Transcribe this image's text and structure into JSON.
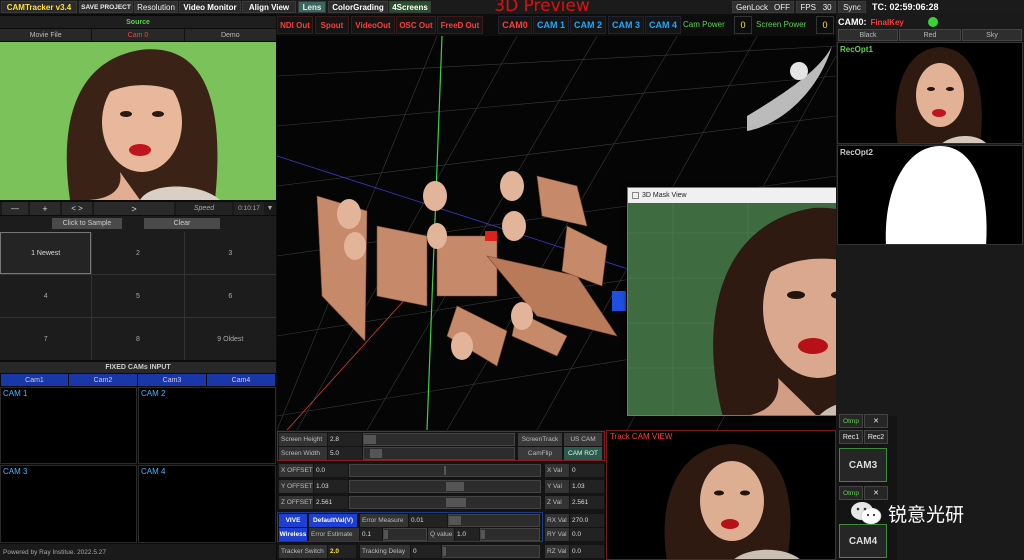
{
  "app": {
    "title": "CAMTracker v3.4",
    "footer": "Powered by Ray Institue. 2022.5.27",
    "watermark": "锐意光研"
  },
  "topbar": {
    "save_project": "SAVE PROJECT",
    "resolution": "Resolution",
    "video_monitor": "Video Monitor",
    "align_view": "Align View",
    "lens": "Lens",
    "color_grading": "ColorGrading",
    "four_screens": "4Screens",
    "genlock_label": "GenLock",
    "genlock_value": "OFF",
    "fps_label": "FPS",
    "fps_value": "30",
    "sync_label": "Sync",
    "timecode": "TC: 02:59:06:28"
  },
  "preview": {
    "title": "3D Preview"
  },
  "outputs": [
    "NDI Out",
    "Spout",
    "VideoOut",
    "OSC Out",
    "FreeD Out"
  ],
  "cams": [
    "CAM0",
    "CAM 1",
    "CAM 2",
    "CAM 3",
    "CAM 4"
  ],
  "cam_power_label": "Cam Power",
  "cam_power_value": "0",
  "screen_power_label": "Screen Power",
  "screen_power_value": "0",
  "source": {
    "header": "Source",
    "tabs": [
      "Movie File",
      "Cam 0",
      "Demo"
    ],
    "transport": {
      "minus": "—",
      "plus": "+",
      "swap": "< >",
      "next": ">",
      "speed_label": "Speed",
      "time": "0:10:17"
    },
    "click_to_sample": "Click to Sample",
    "clear": "Clear",
    "slots": [
      "1 Newest",
      "2",
      "3",
      "4",
      "5",
      "6",
      "7",
      "8",
      "9 Oldest"
    ]
  },
  "fixed_cams": {
    "header": "FIXED CAMs INPUT",
    "selectors": [
      "Cam1",
      "Cam2",
      "Cam3",
      "Cam4"
    ],
    "views": [
      "CAM 1",
      "CAM 2",
      "CAM 3",
      "CAM 4"
    ]
  },
  "controls": {
    "screen_height_label": "Screen Height",
    "screen_height_value": "2.8",
    "screen_width_label": "Screen Width",
    "screen_width_value": "5.0",
    "screen_track": "ScreenTrack",
    "us_cam": "US CAM",
    "cam_flip": "CamFlip",
    "cam_rot": "CAM ROT",
    "x_offset_label": "X OFFSET",
    "x_offset_value": "0.0",
    "y_offset_label": "Y OFFSET",
    "y_offset_value": "1.03",
    "z_offset_label": "Z OFFSET",
    "z_offset_value": "2.561",
    "x_val_label": "X Val",
    "x_val_value": "0",
    "y_val_label": "Y Val",
    "y_val_value": "1.03",
    "z_val_label": "Z Val",
    "z_val_value": "2.561",
    "vive": "VIVE",
    "default_val": "DefaultVal(V)",
    "error_measure_label": "Error Measure",
    "error_measure_value": "0.01",
    "wireless": "Wireless",
    "error_estimate_label": "Error Estimate",
    "error_estimate_value": "0.1",
    "q_value_label": "Q value",
    "q_value_value": "1.0",
    "tracker_switch_label": "Tracker Switch",
    "tracker_switch_value": "2.0",
    "tracking_delay_label": "Tracking Delay",
    "tracking_delay_value": "0",
    "rx_val_label": "RX Val",
    "rx_val_value": "270.0",
    "ry_val_label": "RY Val",
    "ry_val_value": "0.0",
    "rz_val_label": "RZ Val",
    "rz_val_value": "0.0"
  },
  "track_cam": {
    "title": "Track CAM VIEW"
  },
  "right_panel": {
    "cam_label": "CAM0:",
    "cam_mode": "FinalKey",
    "tabs": [
      "Black",
      "Red",
      "Sky"
    ],
    "rec_opt1": "RecOpt1",
    "rec_opt2": "RecOpt2",
    "rec1": "Rec1",
    "rec2": "Rec2",
    "otmp": "Otmp",
    "close": "✕",
    "cam3": "CAM3",
    "cam4": "CAM4"
  },
  "mask_window": {
    "title": "3D Mask View",
    "minimize": "—",
    "maximize": "☐",
    "close": "✕"
  },
  "colors": {
    "accent_red": "#ff3b3b",
    "accent_blue": "#1fa9ff",
    "accent_yellow": "#ffe13a",
    "accent_green": "#5cd34f"
  }
}
